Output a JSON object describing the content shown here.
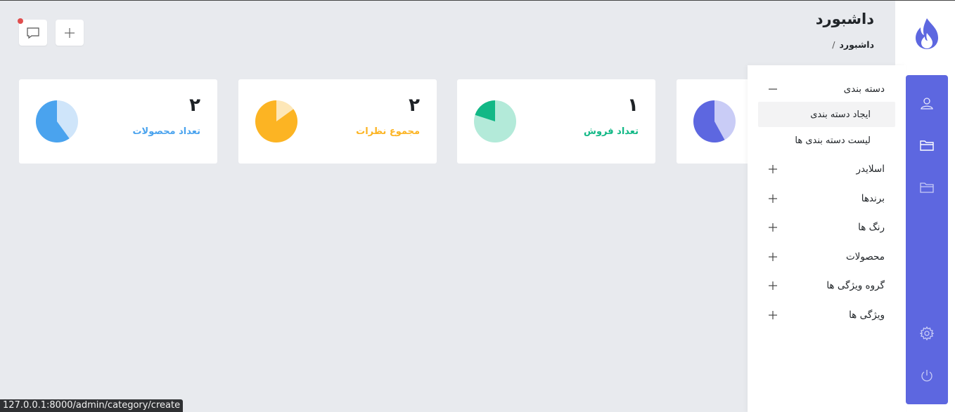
{
  "header": {
    "title": "داشبورد",
    "breadcrumb": {
      "current": "داشبورد",
      "separator": "/"
    }
  },
  "top_actions": {
    "chat": {
      "icon": "chat-icon",
      "has_notification": true
    },
    "add": {
      "icon": "plus-icon"
    }
  },
  "cards": [
    {
      "value": "۲",
      "label": "تعداد محصولات",
      "color": "#4aa3ee",
      "light_color": "#cfe5fa",
      "fraction": 0.6
    },
    {
      "value": "۲",
      "label": "مجموع نظرات",
      "color": "#fcb423",
      "light_color": "#fde7b8",
      "fraction": 0.85
    },
    {
      "value": "۱",
      "label": "تعداد فروش",
      "color": "#12b886",
      "light_color": "#b3ead9",
      "fraction": 0.2
    },
    {
      "value": "",
      "label": "",
      "color": "#5d67e0",
      "light_color": "#c9ccf6",
      "fraction": 0.58
    }
  ],
  "menu": {
    "items": [
      {
        "label": "دسته بندی",
        "expanded": true,
        "children": [
          {
            "label": "ایجاد دسته بندی",
            "active": true
          },
          {
            "label": "لیست دسته بندی ها",
            "active": false
          }
        ]
      },
      {
        "label": "اسلایدر",
        "expanded": false
      },
      {
        "label": "برندها",
        "expanded": false
      },
      {
        "label": "رنگ ها",
        "expanded": false
      },
      {
        "label": "محصولات",
        "expanded": false
      },
      {
        "label": "گروه ویژگی ها",
        "expanded": false
      },
      {
        "label": "ویژگی ها",
        "expanded": false
      }
    ]
  },
  "rail": {
    "icons": [
      "user-icon",
      "folder-icon",
      "folder-icon",
      "gear-icon",
      "power-icon"
    ],
    "accent": "#5d67e0"
  },
  "statusbar": {
    "url": "127.0.0.1:8000/admin/category/create"
  }
}
